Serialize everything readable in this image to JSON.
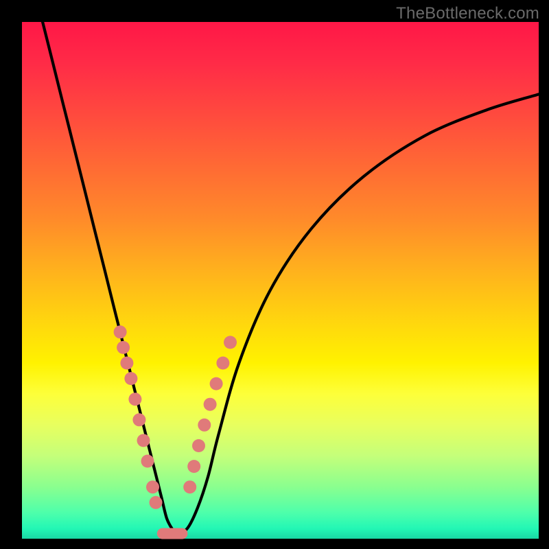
{
  "watermark": "TheBottleneck.com",
  "chart_data": {
    "type": "line",
    "title": "",
    "xlabel": "",
    "ylabel": "",
    "xlim": [
      0,
      100
    ],
    "ylim": [
      0,
      100
    ],
    "series": [
      {
        "name": "bottleneck-curve",
        "x": [
          4,
          6,
          8,
          10,
          12,
          14,
          16,
          18,
          20,
          22,
          24,
          26,
          27,
          28,
          29,
          30,
          32,
          34,
          36,
          38,
          42,
          48,
          56,
          66,
          78,
          90,
          100
        ],
        "values": [
          100,
          92,
          84,
          76,
          68,
          60,
          52,
          44,
          36,
          28,
          20,
          12,
          8,
          4,
          2,
          1,
          2,
          6,
          12,
          20,
          34,
          48,
          60,
          70,
          78,
          83,
          86
        ]
      }
    ],
    "markers": {
      "name": "highlighted-points",
      "left_cluster": {
        "x": [
          19.0,
          19.6,
          20.3,
          21.1,
          21.9,
          22.7,
          23.5,
          24.3,
          25.3,
          25.9
        ],
        "values": [
          40,
          37,
          34,
          31,
          27,
          23,
          19,
          15,
          10,
          7
        ]
      },
      "right_cluster": {
        "x": [
          32.5,
          33.3,
          34.2,
          35.3,
          36.4,
          37.6,
          38.9,
          40.3
        ],
        "values": [
          10,
          14,
          18,
          22,
          26,
          30,
          34,
          38
        ]
      },
      "bottom_flat": {
        "x": [
          27.2,
          31.0
        ],
        "y": 1
      }
    },
    "background_gradient_stops": [
      {
        "pos": 0,
        "color": "#ff1747"
      },
      {
        "pos": 18,
        "color": "#ff4a3e"
      },
      {
        "pos": 38,
        "color": "#ff8a2a"
      },
      {
        "pos": 58,
        "color": "#ffd60e"
      },
      {
        "pos": 72,
        "color": "#fdff3a"
      },
      {
        "pos": 90,
        "color": "#8aff8f"
      },
      {
        "pos": 100,
        "color": "#19d7a4"
      }
    ]
  }
}
